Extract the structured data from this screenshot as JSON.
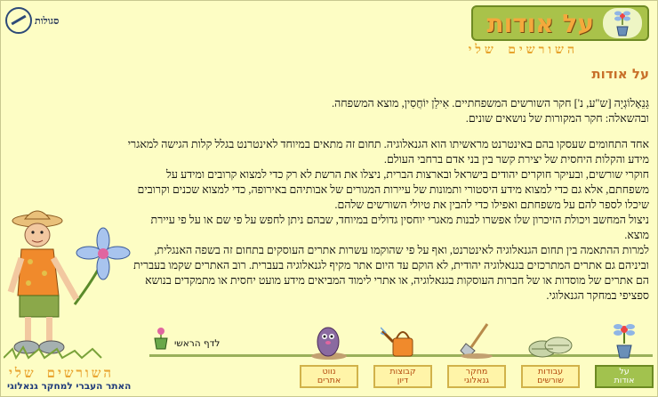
{
  "org_logo": {
    "name": "סגולות"
  },
  "banner": {
    "title": "על אודות"
  },
  "site_name": "השורשים שלי",
  "site_tagline": "האתר העברי למחקר גנאלוגי",
  "content": {
    "heading": "על אודות",
    "paragraphs": [
      "גֵּנֵאָלוֹגְיָה [ש\"ע, נ'] חקר השורשים המשפחתיים. אִילַן יוֹחֲסִין, מוצא המשפחה.\nובהשאלה: חקר המקורות של נושאים שונים.",
      "אחד התחומים שעסקו בהם באינטרנט מראשיתו הוא הגנאלוגיה. תחום זה מתאים במיוחד לאינטרנט בגלל קלות הגישה למאגרי מידע והקלות היחסית של יצירת קשר בין בני אדם ברחבי העולם.\nחוקרי שורשים, ובעיקר חוקרים יהודים בישראל ובארצות הברית, ניצלו את הרשת לא רק כדי למצוא קרובים ומידע על משפחתם, אלא גם כדי למצוא מידע היסטורי ותמונות של עיירות המגורים של אבותיהם באירופה, כדי למצוא שכנים וקרובים שיכלו לספר להם על משפחתם ואפילו כדי להבין את טיולי השורשים שלהם.\nניצול המחשב ויכולת הזיכרון שלו אפשרו לבנות מאגרי יוחסין גדולים במיוחד, שבהם ניתן לחפש על פי שם או על פי עיירת מוצא.\nלמרות ההתאמה בין תחום הגנאלוגיה לאינטרנט, ואף על פי שהוקמו עשרות אתרים העוסקים בתחום זה בשפה האנגלית, וביניהם גם אתרים המתרכזים בגנאלוגיה יהודית, לא הוקם עד היום אתר מקיף לגנאלוגיה בעברית. רוב האתרים שקמו בעברית הם אתרים של מוסדות או של חברות העוסקות בגנאלוגיה, או אתרי לימוד המביאים מידע מועט יחסית או מתמקדים בנושא ספציפי במחקר הגנאלוגי."
    ]
  },
  "home_link": {
    "label": "לדף הראשי"
  },
  "nav": [
    {
      "label": "על\nאודות",
      "icon": "flower-pot-icon",
      "active": true
    },
    {
      "label": "עבודות\nשורשים",
      "icon": "leaves-icon",
      "active": false
    },
    {
      "label": "מחקר\nגנאלוגי",
      "icon": "shovel-icon",
      "active": false
    },
    {
      "label": "קבוצות\nדיון",
      "icon": "watering-can-icon",
      "active": false
    },
    {
      "label": "נווט\nאתרים",
      "icon": "mole-icon",
      "active": false
    }
  ],
  "colors": {
    "background": "#fdfdc4",
    "banner_green": "#a9c24a",
    "title_orange": "#f4a93c",
    "heading_orange": "#c8702a",
    "nav_text": "#b34a0e",
    "tagline_blue": "#1e3a7a"
  }
}
